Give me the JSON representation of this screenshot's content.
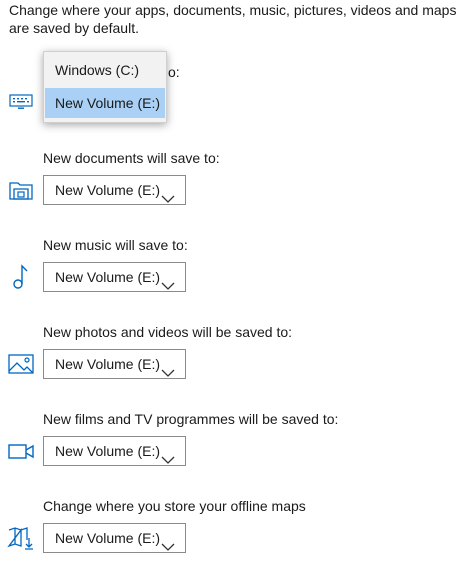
{
  "intro_text": "Change where your apps, documents, music, pictures, videos and maps are saved by default.",
  "apps": {
    "label_visible_fragment": "o:",
    "dropdown": {
      "options": [
        "Windows (C:)",
        "New Volume (E:)"
      ],
      "selected": "New Volume (E:)"
    },
    "icon": "keyboard-icon"
  },
  "documents": {
    "label": "New documents will save to:",
    "value": "New Volume (E:)",
    "icon": "documents-folder-icon"
  },
  "music": {
    "label": "New music will save to:",
    "value": "New Volume (E:)",
    "icon": "music-note-icon"
  },
  "photos": {
    "label": "New photos and videos will be saved to:",
    "value": "New Volume (E:)",
    "icon": "picture-icon"
  },
  "films": {
    "label": "New films and TV programmes will be saved to:",
    "value": "New Volume (E:)",
    "icon": "video-camera-icon"
  },
  "maps": {
    "label": "Change where you store your offline maps",
    "value": "New Volume (E:)",
    "icon": "offline-map-icon"
  },
  "colors": {
    "accent": "#0067c0",
    "selected_option_bg": "#aad0f5"
  }
}
